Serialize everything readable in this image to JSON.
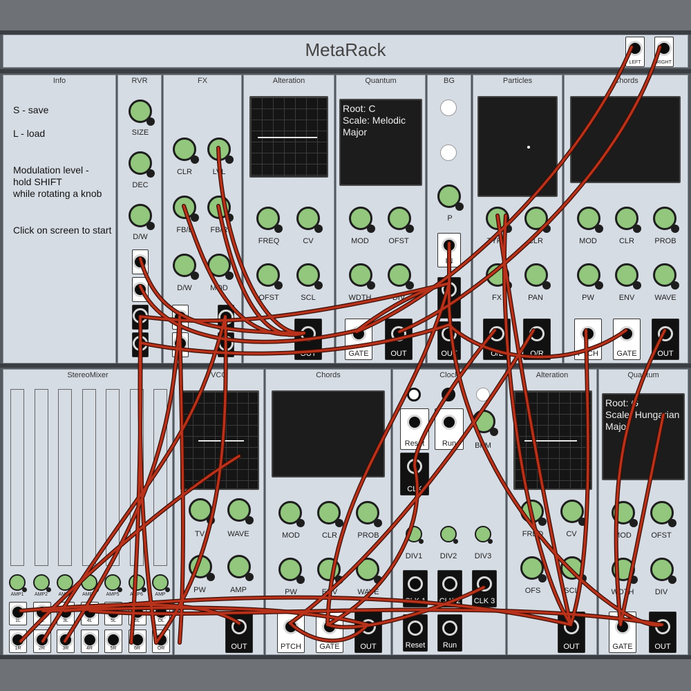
{
  "app": {
    "title": "MetaRack"
  },
  "top_panel": {
    "outputs": [
      "LEFT",
      "RIGHT"
    ]
  },
  "info": {
    "title": "Info",
    "lines": [
      "S - save",
      "L - load",
      "Modulation level -\nhold SHIFT\nwhile rotating a knob",
      "Click on screen to start"
    ]
  },
  "rvr": {
    "title": "RVR",
    "knobs": [
      "SIZE",
      "DEC",
      "D/W"
    ],
    "jacks": [
      "C",
      "C"
    ]
  },
  "fx": {
    "title": "FX",
    "knobs": [
      "CLR",
      "LVL",
      "FB/L",
      "FB/R",
      "D/W",
      "MOD"
    ],
    "jacks": [
      "L",
      "R"
    ]
  },
  "alteration1": {
    "title": "Alteration",
    "knobs": [
      "FREQ",
      "CV",
      "OFST",
      "SCL"
    ],
    "output": "OUT"
  },
  "quantum1": {
    "title": "Quantum",
    "screen": "Root: C\nScale: Melodic\nMajor",
    "knobs": [
      "MOD",
      "OFST",
      "WDTH",
      "DIV"
    ],
    "buttons": [
      "GATE",
      "OUT"
    ]
  },
  "bg": {
    "title": "BG",
    "knob": "P",
    "jacks": [
      "IN",
      "OUT"
    ]
  },
  "particles": {
    "title": "Particles",
    "knobs": [
      "TYPE",
      "CLR",
      "FX",
      "PAN"
    ],
    "buttons": [
      "O/L",
      "O/R"
    ]
  },
  "chords1": {
    "title": "Chords",
    "knobs": [
      "MOD",
      "CLR",
      "PROB",
      "PW",
      "ENV",
      "WAVE"
    ],
    "buttons": [
      "PTCH",
      "GATE",
      "OUT"
    ]
  },
  "stereomixer": {
    "title": "StereoMixer",
    "amp_labels": [
      "AMP1",
      "AMP2",
      "AMP3",
      "AMP4",
      "AMP5",
      "AMP6",
      "AMP"
    ],
    "top_jacks": [
      "1L",
      "2L",
      "3L",
      "4L",
      "5L",
      "6L",
      "OL"
    ],
    "bottom_jacks": [
      "1R",
      "2R",
      "3R",
      "4R",
      "5R",
      "6R",
      "OR"
    ]
  },
  "vco": {
    "title": "VCO",
    "knobs": [
      "TV",
      "WAVE",
      "PW",
      "AMP"
    ],
    "output": "OUT"
  },
  "chords2": {
    "title": "Chords",
    "knobs": [
      "MOD",
      "CLR",
      "PROB",
      "PW",
      "ENV",
      "WAVE"
    ],
    "buttons": [
      "PTCH",
      "GATE",
      "OUT"
    ]
  },
  "clock": {
    "title": "Clock",
    "buttons": [
      "Reset",
      "Run"
    ],
    "knobs": [
      "BPM",
      "DIV1",
      "DIV2",
      "DIV3"
    ],
    "clk": "CLK",
    "outs": [
      "CLK 1",
      "CLK 2",
      "CLK 3"
    ],
    "bottom_buttons": [
      "Reset",
      "Run"
    ]
  },
  "alteration2": {
    "title": "Alteration",
    "knobs": [
      "FREQ",
      "CV",
      "OFS",
      "SCL"
    ],
    "output": "OUT"
  },
  "quantum2": {
    "title": "Quantum",
    "screen": "Root: G\nScale: Hungarian\nMajor",
    "knobs": [
      "MOD",
      "OFST",
      "WDTH",
      "DIV"
    ],
    "buttons": [
      "GATE",
      "OUT"
    ]
  },
  "colors": {
    "panel": "#d6dce4",
    "knob": "#92c77d",
    "cable": "#b8321b",
    "rack": "#555a60"
  }
}
